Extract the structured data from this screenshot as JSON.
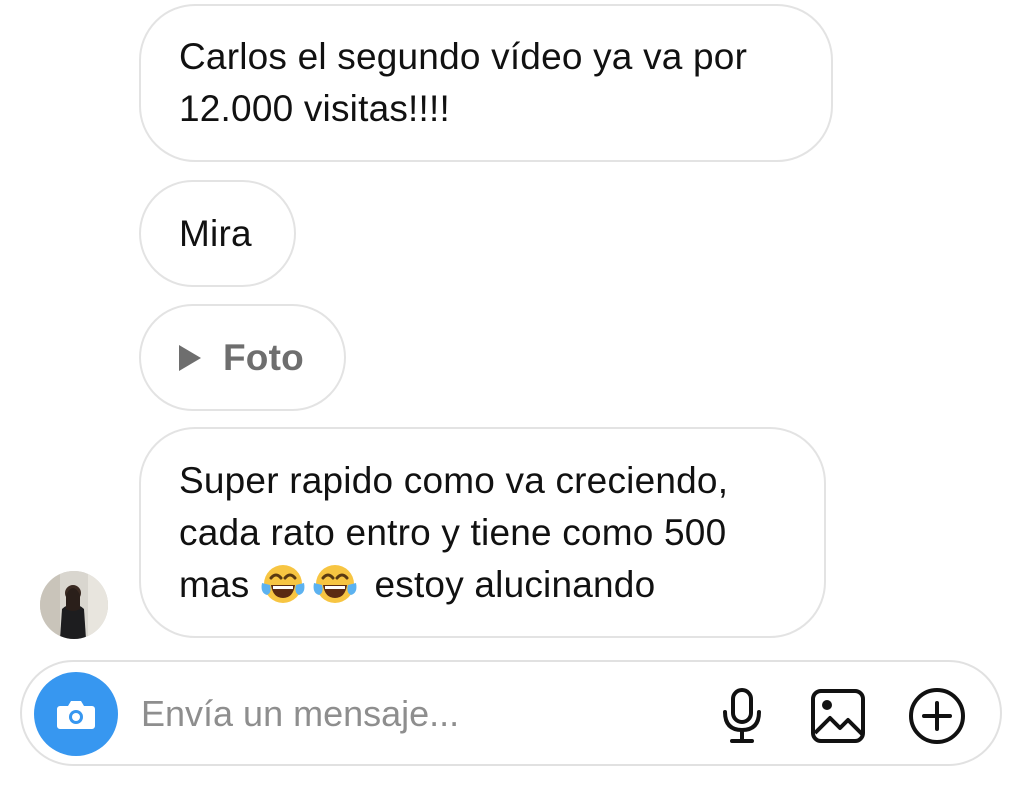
{
  "messages": [
    {
      "type": "text",
      "line1": "Carlos el segundo vídeo ya va por",
      "line2": "12.000 visitas!!!!"
    },
    {
      "type": "text",
      "text": "Mira"
    },
    {
      "type": "media",
      "label": "Foto",
      "icon": "play-icon"
    },
    {
      "type": "text",
      "line1": "Super rapido como va creciendo,",
      "line2": "cada rato entro y tiene como 500",
      "line3_prefix": "mas",
      "emojis": [
        "face-with-tears-of-joy",
        "face-with-tears-of-joy"
      ],
      "line3_suffix": "estoy alucinando"
    }
  ],
  "composer": {
    "placeholder": "Envía un mensaje...",
    "camera_icon": "camera-icon",
    "camera_color": "#3797f0",
    "tools": [
      "microphone-icon",
      "gallery-icon",
      "plus-circle-icon"
    ]
  },
  "colors": {
    "bubble_border": "#e3e3e3",
    "text": "#111111",
    "muted": "#6e6e6e"
  }
}
